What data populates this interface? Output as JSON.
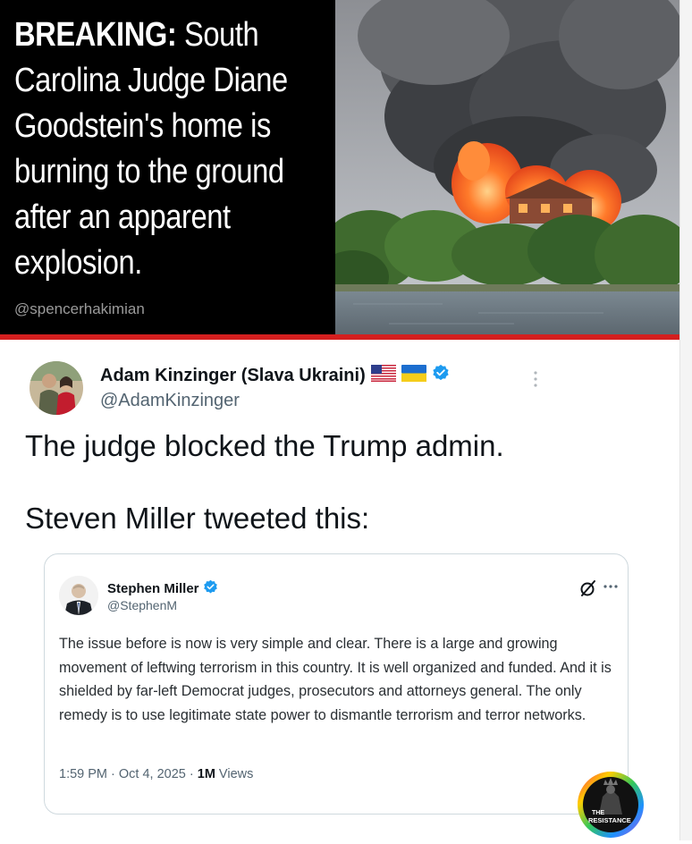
{
  "banner": {
    "keyword": "BREAKING:",
    "headline": " South Carolina Judge Diane Goodstein's home is burning to the ground after an apparent explosion.",
    "handle": "@spencerhakimian",
    "photo_subject": "house-on-fire-photo"
  },
  "kinzinger_tweet": {
    "display_name": "Adam Kinzinger (Slava Ukraini)",
    "handle": "@AdamKinzinger",
    "flags": [
      "us-flag-icon",
      "ukraine-flag-icon"
    ],
    "verified_icon": "verified-badge-icon",
    "more_icon": "vertical-ellipsis-icon",
    "body_line_1": "The judge blocked the Trump admin.",
    "body_line_2": "Steven Miller tweeted this:"
  },
  "quoted_tweet": {
    "display_name": "Stephen Miller",
    "handle": "@StephenM",
    "verified_icon": "verified-badge-icon",
    "grok_icon": "grok-icon",
    "more_icon": "horizontal-ellipsis-icon",
    "body": "The issue before is now is very simple and clear. There is a large and growing movement of leftwing terrorism in this country. It is well organized and funded. And it is shielded by far-left Democrat judges, prosecutors and attorneys general. The only remedy is to use legitimate state power to dismantle terrorism and terror networks.",
    "timestamp": "1:59 PM · Oct 4, 2025 · ",
    "views_count": "1M",
    "views_label": " Views"
  },
  "watermark": {
    "line1": "THE",
    "line2": "RESISTANCE"
  },
  "colors": {
    "banner_bg": "#000000",
    "breaking_red": "#d41f1f",
    "verified_blue": "#1d9bf0",
    "text_primary": "#0f1419",
    "text_secondary": "#536471",
    "card_border": "#cfd9de"
  }
}
